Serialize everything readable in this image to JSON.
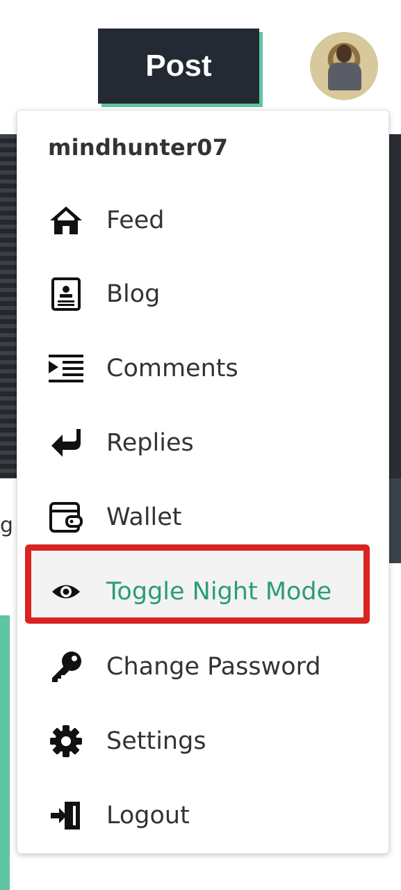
{
  "header": {
    "post_label": "Post",
    "avatar_alt": "user avatar"
  },
  "menu": {
    "username": "mindhunter07",
    "items": [
      {
        "label": "Feed",
        "icon": "home-icon"
      },
      {
        "label": "Blog",
        "icon": "blog-icon"
      },
      {
        "label": "Comments",
        "icon": "comments-icon"
      },
      {
        "label": "Replies",
        "icon": "reply-icon"
      },
      {
        "label": "Wallet",
        "icon": "wallet-icon"
      },
      {
        "label": "Toggle Night Mode",
        "icon": "eye-icon",
        "active": true
      },
      {
        "label": "Change Password",
        "icon": "key-icon"
      },
      {
        "label": "Settings",
        "icon": "gear-icon"
      },
      {
        "label": "Logout",
        "icon": "logout-icon"
      }
    ]
  },
  "colors": {
    "accent": "#5fc4a0",
    "active_text": "#2a9d73",
    "highlight": "#d9231f",
    "button_bg": "#232a33"
  },
  "background": {
    "peek_text": "g"
  }
}
